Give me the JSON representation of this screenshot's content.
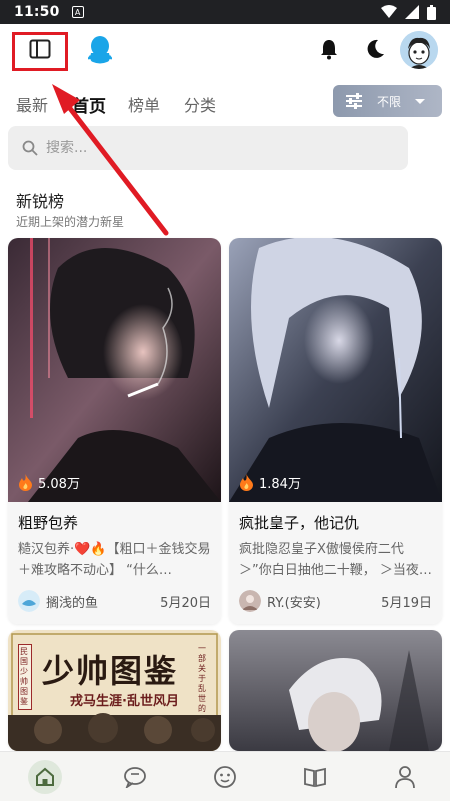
{
  "status_bar": {
    "time": "11:50"
  },
  "top_bar": {
    "icons": [
      "sidebar-toggle-icon",
      "qq-icon",
      "bell-icon",
      "moon-icon"
    ]
  },
  "tabs": [
    {
      "label": "最新"
    },
    {
      "label": "首页",
      "active": true
    },
    {
      "label": "榜单"
    },
    {
      "label": "分类"
    }
  ],
  "filter": {
    "label": "不限"
  },
  "search": {
    "placeholder": "搜索..."
  },
  "section": {
    "title": "新锐榜",
    "subtitle": "近期上架的潜力新星"
  },
  "cards": [
    {
      "heat": "5.08万",
      "title": "粗野包养",
      "desc": "糙汉包养·❤️🔥【粗口＋金钱交易＋难攻略不动心】 “什么…",
      "author": "搁浅的鱼",
      "date": "5月20日"
    },
    {
      "heat": "1.84万",
      "title": "疯批皇子，他记仇",
      "desc": "疯批隐忍皇子X傲慢侯府二代＞”你白日抽他二十鞭， ＞当夜…",
      "author": "RY.(安安)",
      "date": "5月19日"
    },
    {
      "poster_title": "少帅图鉴",
      "poster_sub": "戎马生涯·乱世风月",
      "poster_left": "民国少帅图鉴",
      "poster_right": "一部关于乱世的"
    }
  ],
  "colors": {
    "accent": "#e01b24",
    "filter_bg": "#9aa4b6",
    "nav_active": "#dfe8dc"
  },
  "bottom_nav": [
    "home-icon",
    "chat-icon",
    "emoji-icon",
    "book-icon",
    "profile-icon"
  ]
}
